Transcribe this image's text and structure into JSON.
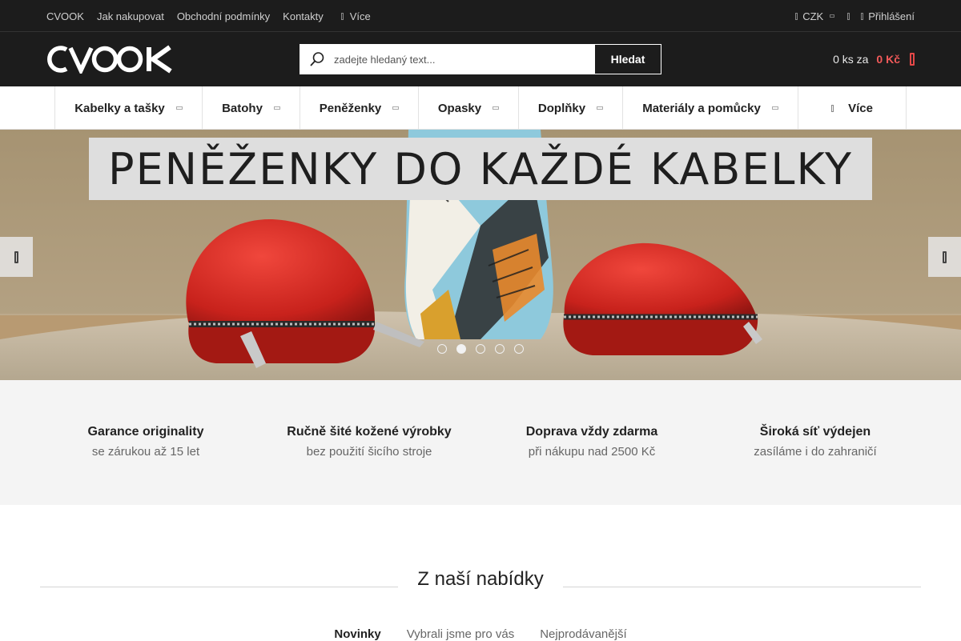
{
  "topbar": {
    "links": [
      "CVOOK",
      "Jak nakupovat",
      "Obchodní podmínky",
      "Kontakty"
    ],
    "more": "Více",
    "currency": "CZK",
    "login": "Přihlášení"
  },
  "header": {
    "logo_text": "CVOOK",
    "search_placeholder": "zadejte hledaný text...",
    "search_button": "Hledat",
    "cart_count": "0 ks za",
    "cart_price": "0 Kč"
  },
  "nav": {
    "items": [
      "Kabelky a tašky",
      "Batohy",
      "Peněženky",
      "Opasky",
      "Doplňky",
      "Materiály a pomůcky"
    ],
    "more": "Více"
  },
  "slider": {
    "banner_text": "PENĚŽENKY DO KAŽDÉ KABELKY",
    "dot_count": 5,
    "active_dot": 2
  },
  "benefits": [
    {
      "title": "Garance originality",
      "subtitle": "se zárukou až 15 let"
    },
    {
      "title": "Ručně šité kožené výrobky",
      "subtitle": "bez použití šicího stroje"
    },
    {
      "title": "Doprava vždy zdarma",
      "subtitle": "při nákupu nad 2500 Kč"
    },
    {
      "title": "Široká síť výdejen",
      "subtitle": "zasíláme i do zahraničí"
    }
  ],
  "offers": {
    "title": "Z naší nabídky",
    "tabs": [
      "Novinky",
      "Vybrali jsme pro vás",
      "Nejprodávanější"
    ],
    "active_tab": 0
  },
  "colors": {
    "dark_bg": "#1c1c1c",
    "accent_red": "#e54848",
    "benefits_bg": "#f4f4f4"
  }
}
